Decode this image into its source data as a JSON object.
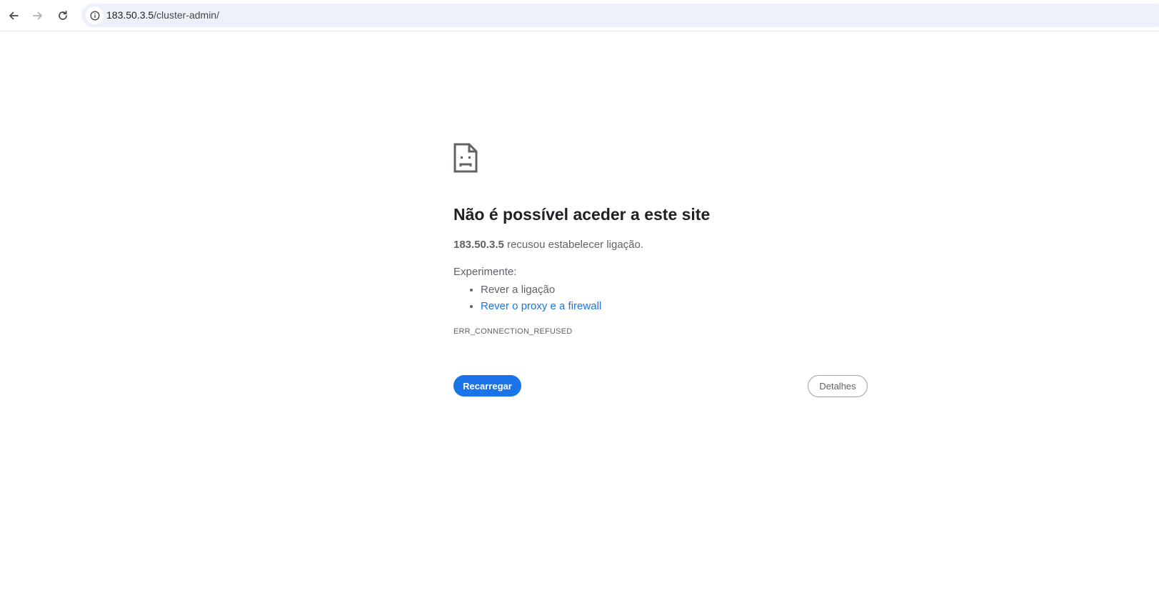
{
  "toolbar": {
    "back_icon": "arrow-left-icon",
    "forward_icon": "arrow-right-icon",
    "reload_icon": "reload-icon",
    "site_info_icon": "info-icon",
    "url_host": "183.50.3.5",
    "url_path": "/cluster-admin/"
  },
  "error_page": {
    "icon": "sad-page-icon",
    "heading": "Não é possível aceder a este site",
    "host": "183.50.3.5",
    "message": " recusou estabelecer ligação.",
    "suggestions_label": "Experimente:",
    "suggestions": [
      "Rever a ligação",
      "Rever o proxy e a firewall"
    ],
    "error_code": "ERR_CONNECTION_REFUSED",
    "reload_label": "Recarregar",
    "details_label": "Detalhes"
  },
  "colors": {
    "accent": "#1a73e8",
    "omnibox_bg": "#edf2fa",
    "text_secondary": "#5f6368"
  }
}
